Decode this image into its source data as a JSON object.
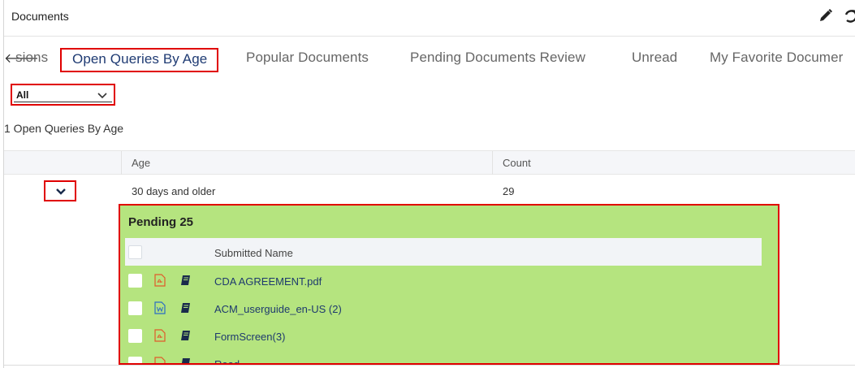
{
  "header": {
    "title": "Documents",
    "edit_icon": "pencil-icon",
    "refresh_icon": "refresh-icon"
  },
  "tabs": {
    "prev_arrow": "🡐",
    "items": [
      {
        "label": "sions"
      },
      {
        "label": "Open Queries By Age",
        "active": true
      },
      {
        "label": "Popular Documents"
      },
      {
        "label": "Pending Documents Review"
      },
      {
        "label": "Unread"
      },
      {
        "label": "My Favorite Documer"
      }
    ]
  },
  "filter": {
    "selected": "All"
  },
  "summary": "1 Open Queries By Age",
  "table": {
    "columns": [
      "Age",
      "Count"
    ],
    "rows": [
      {
        "age": "30 days and older",
        "count": "29"
      }
    ]
  },
  "pending": {
    "title": "Pending 25",
    "column": "Submitted Name",
    "documents": [
      {
        "name": "CDA AGREEMENT.pdf",
        "type": "pdf-file-icon"
      },
      {
        "name": "ACM_userguide_en-US (2)",
        "type": "word-file-icon"
      },
      {
        "name": "FormScreen(3)",
        "type": "pdf-file-icon"
      },
      {
        "name": "Read...",
        "type": "pdf-file-icon"
      }
    ]
  },
  "colors": {
    "accent_red": "#e00000",
    "panel_green": "#b5e47f",
    "active_tab": "#1f3b73"
  }
}
